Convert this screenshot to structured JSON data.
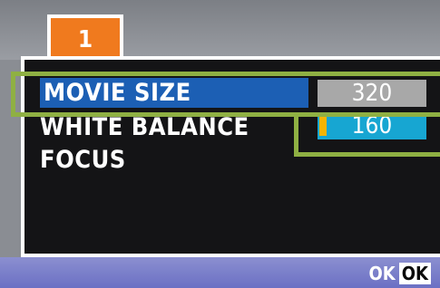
{
  "tab": {
    "label": "1"
  },
  "menu": {
    "items": [
      {
        "label": "MOVIE SIZE",
        "selected": true
      },
      {
        "label": "WHITE BALANCE",
        "selected": false
      },
      {
        "label": "FOCUS",
        "selected": false
      }
    ]
  },
  "options": [
    {
      "label": "320",
      "color": "#a8a8a8"
    },
    {
      "label": "160",
      "color": "#17a6d2",
      "cursor": true
    }
  ],
  "footer": {
    "ok_text": "OK",
    "ok_key": "OK"
  },
  "colors": {
    "tab": "#f07a1e",
    "menu_highlight": "#1c5fb4",
    "callout": "#8fb043",
    "bottom_bar": "#7a7fca",
    "cursor": "#f6b400"
  }
}
